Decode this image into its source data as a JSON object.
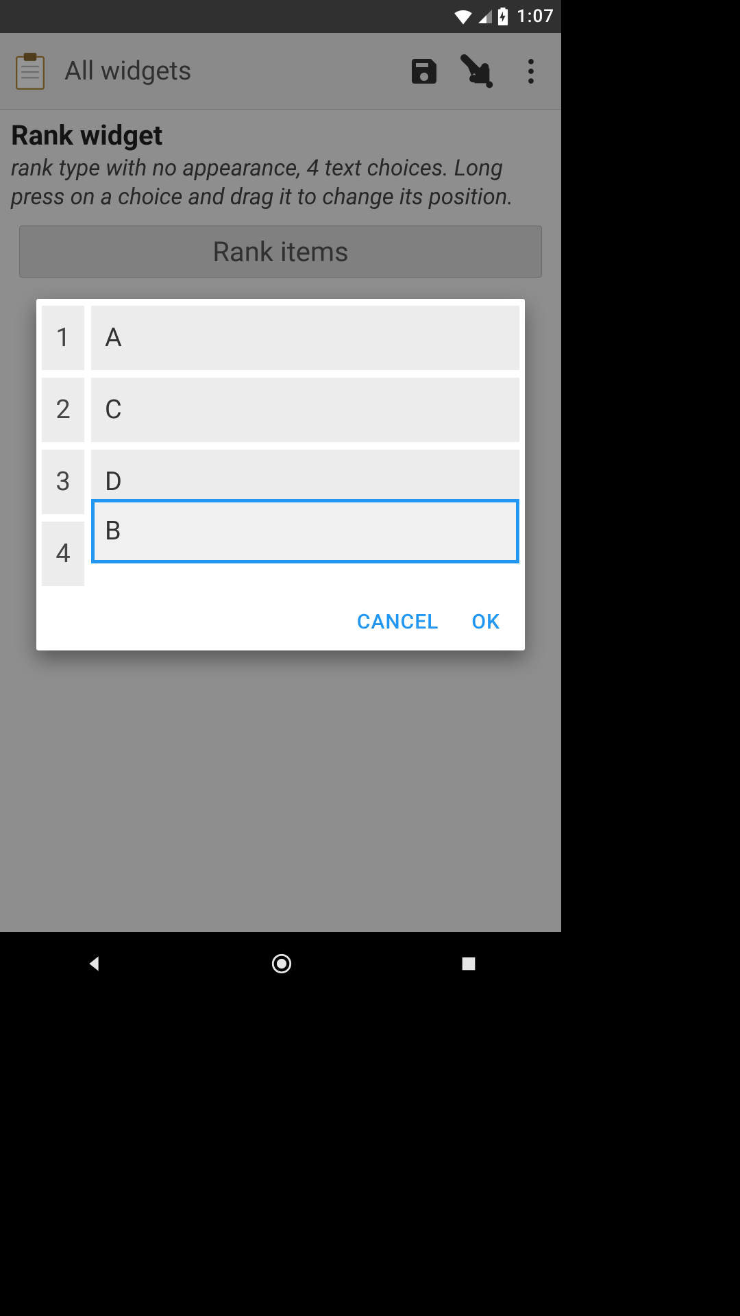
{
  "status_bar": {
    "time": "1:07"
  },
  "action_bar": {
    "title": "All widgets"
  },
  "page": {
    "heading": "Rank widget",
    "description": "rank type with no appearance, 4 text choices. Long press on a choice and drag it to change its position.",
    "rank_button_label": "Rank items"
  },
  "dialog": {
    "numbers": [
      "1",
      "2",
      "3",
      "4"
    ],
    "items": [
      {
        "label": "A",
        "dragging": false
      },
      {
        "label": "C",
        "dragging": false
      },
      {
        "label": "D",
        "dragging": false
      },
      {
        "label": "B",
        "dragging": true
      }
    ],
    "cancel_label": "CANCEL",
    "ok_label": "OK"
  },
  "colors": {
    "accent": "#2196f3"
  }
}
